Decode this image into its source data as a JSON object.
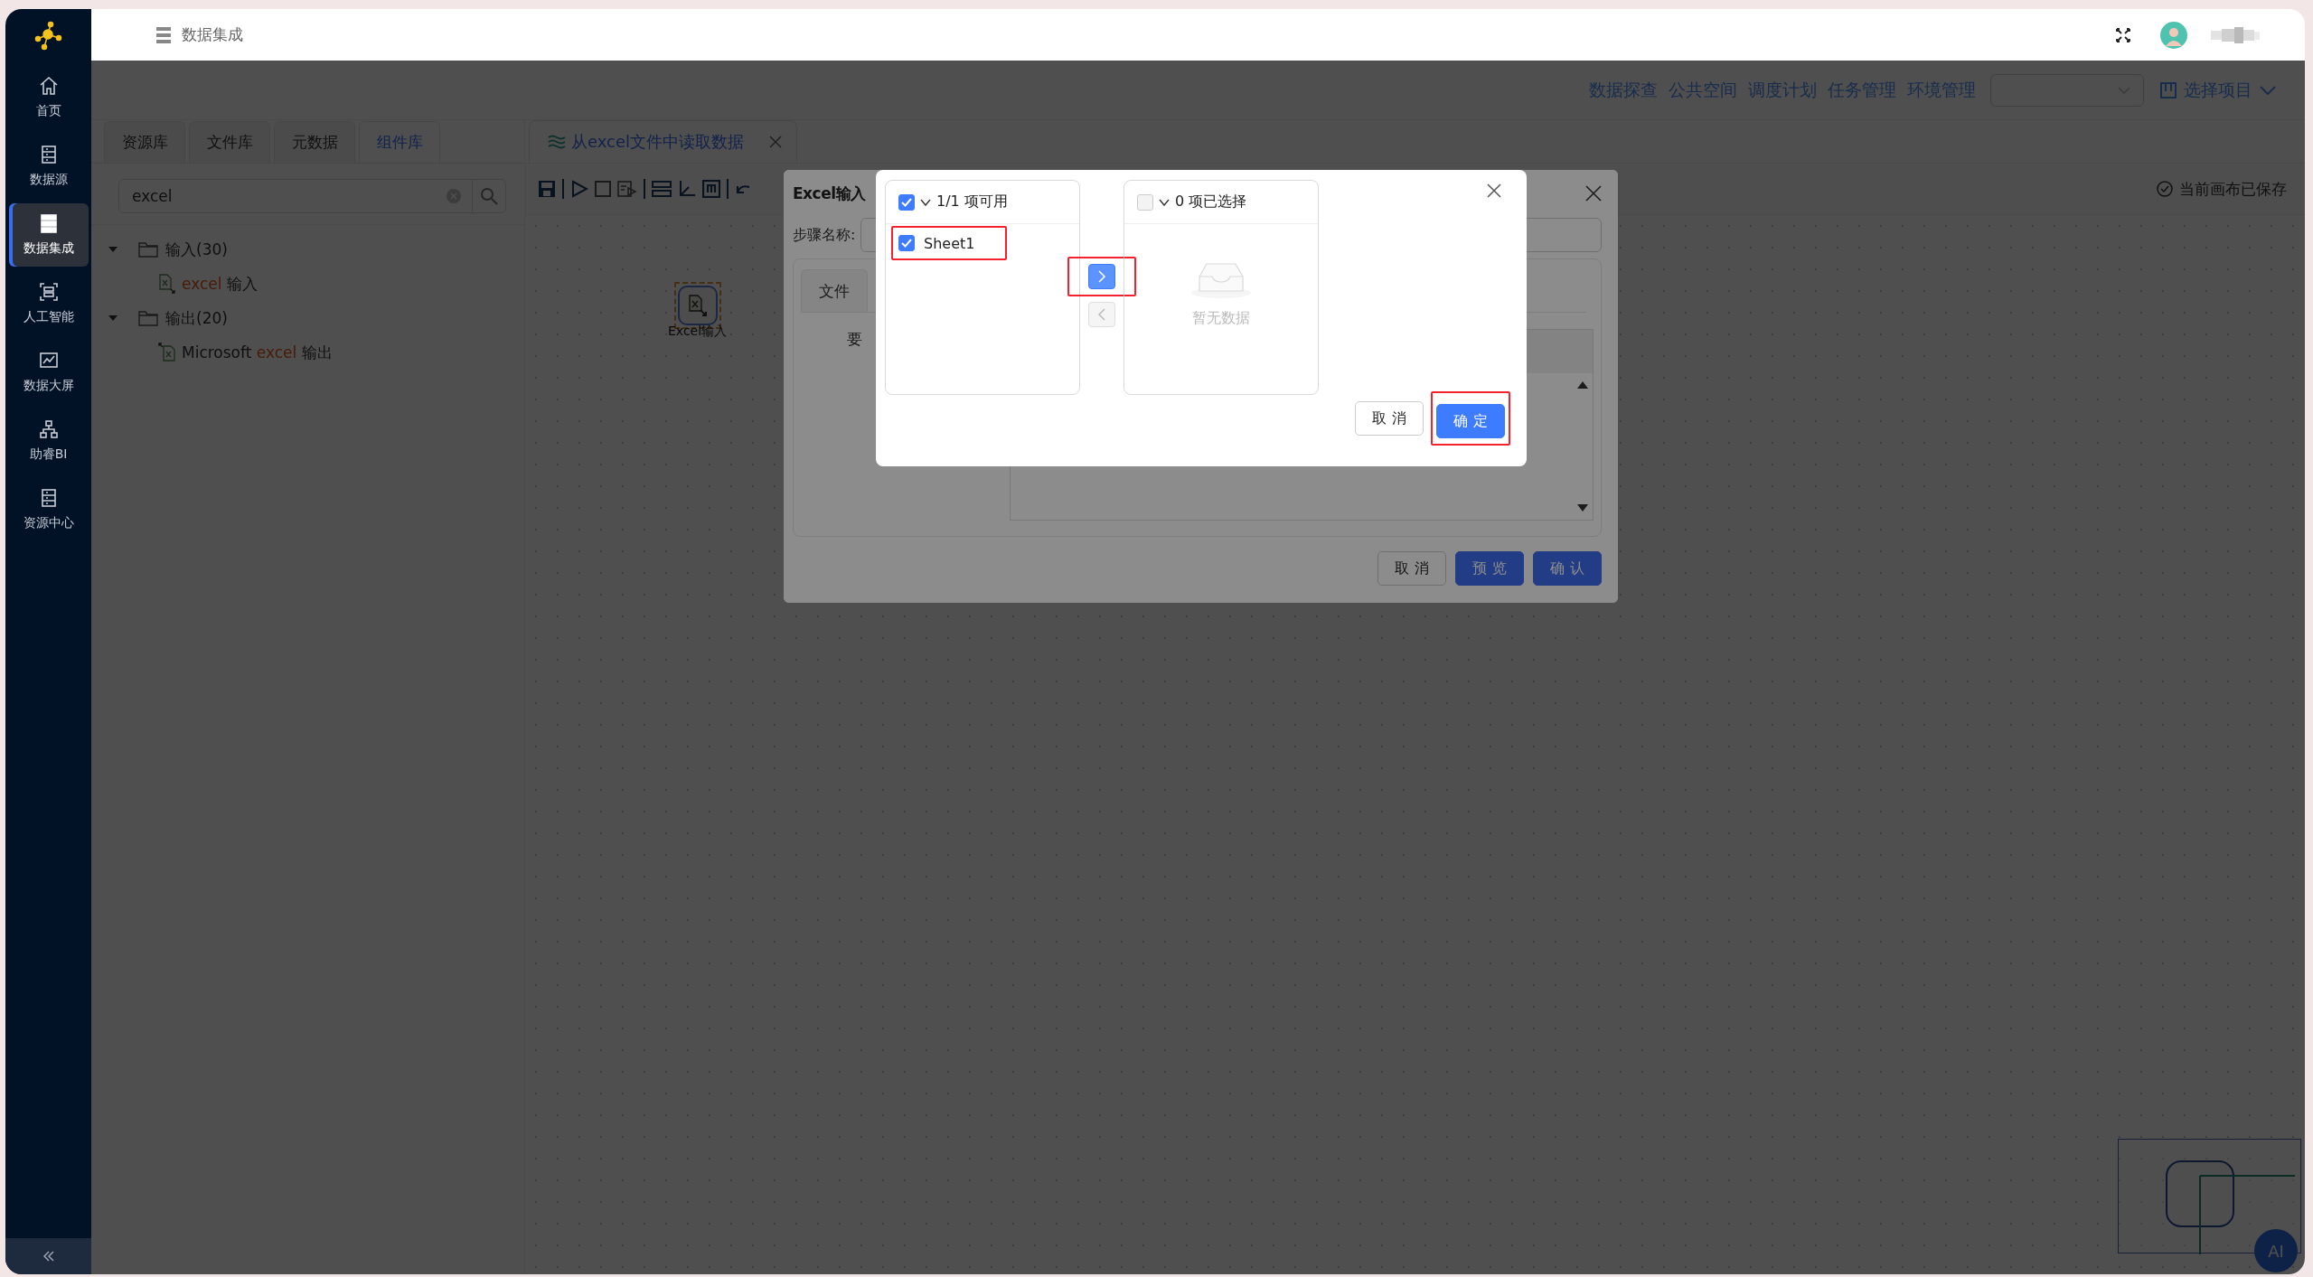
{
  "sidebar": {
    "items": [
      {
        "label": "首页",
        "selected": false
      },
      {
        "label": "数据源",
        "selected": false
      },
      {
        "label": "数据集成",
        "selected": true
      },
      {
        "label": "人工智能",
        "selected": false
      },
      {
        "label": "数据大屏",
        "selected": false
      },
      {
        "label": "助睿BI",
        "selected": false
      },
      {
        "label": "资源中心",
        "selected": false
      }
    ]
  },
  "header": {
    "title": "数据集成"
  },
  "top_nav": {
    "links": [
      "数据探查",
      "公共空间",
      "调度计划",
      "任务管理",
      "环境管理"
    ],
    "project_label": "选择项目"
  },
  "left_panel": {
    "tabs": [
      {
        "label": "资源库",
        "selected": false
      },
      {
        "label": "文件库",
        "selected": false
      },
      {
        "label": "元数据",
        "selected": false
      },
      {
        "label": "组件库",
        "selected": true
      }
    ],
    "search": {
      "value": "excel"
    },
    "tree": [
      {
        "label": "输入(30)",
        "expanded": true,
        "children": [
          {
            "kind": "input",
            "parts": [
              {
                "text": "excel",
                "highlight": true
              },
              {
                "text": " 输入",
                "highlight": false
              }
            ]
          }
        ]
      },
      {
        "label": "输出(20)",
        "expanded": true,
        "children": [
          {
            "kind": "output",
            "parts": [
              {
                "text": "Microsoft ",
                "highlight": false
              },
              {
                "text": "excel",
                "highlight": true
              },
              {
                "text": " 输出",
                "highlight": false
              }
            ]
          }
        ]
      }
    ]
  },
  "editor_tab": {
    "title": "从excel文件中读取数据"
  },
  "save_status": "当前画布已保存",
  "assistant_button": "AI",
  "canvas": {
    "node": {
      "label": "Excel输入",
      "selected": true
    }
  },
  "step_dialog": {
    "title": "Excel输入",
    "step_name_label": "步骤名称:",
    "tabs": [
      {
        "label": "文件"
      }
    ],
    "field_label": "要",
    "buttons": [
      {
        "label": "取 消",
        "kind": "default"
      },
      {
        "label": "预 览",
        "kind": "primary"
      },
      {
        "label": "确 认",
        "kind": "primary"
      }
    ]
  },
  "sheet_dialog": {
    "source": {
      "all_checked": true,
      "count": "1/1 项可用",
      "items": [
        {
          "label": "Sheet1",
          "checked": true
        }
      ]
    },
    "target": {
      "all_checked": false,
      "count": "0 项已选择",
      "empty_text": "暂无数据"
    },
    "transfer_buttons": [
      {
        "kind": "right",
        "disabled": false
      },
      {
        "kind": "left",
        "disabled": true
      }
    ],
    "buttons": [
      {
        "label": "取 消",
        "kind": "default"
      },
      {
        "label": "确 定",
        "kind": "primary"
      }
    ]
  }
}
